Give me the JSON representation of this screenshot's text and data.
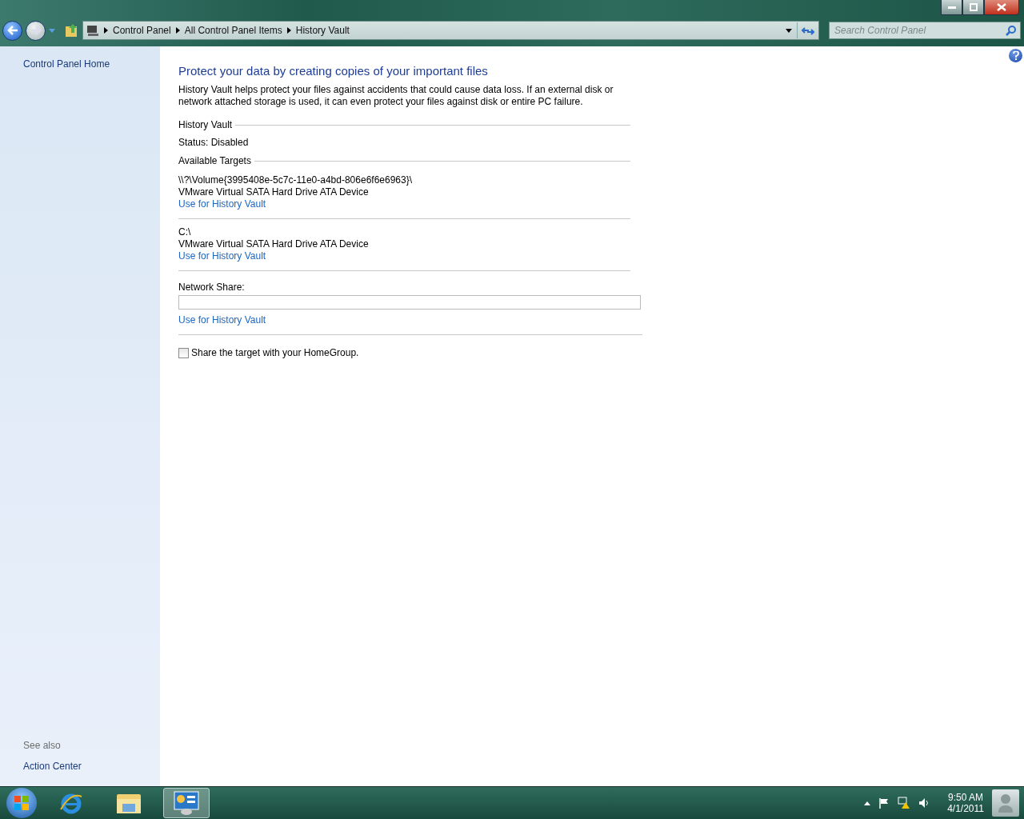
{
  "address_bar": {
    "breadcrumbs": [
      "Control Panel",
      "All Control Panel Items",
      "History Vault"
    ]
  },
  "search": {
    "placeholder": "Search Control Panel"
  },
  "sidebar": {
    "items": [
      "Control Panel Home"
    ],
    "see_also_title": "See also",
    "see_also": [
      "Action Center"
    ]
  },
  "main": {
    "heading": "Protect your data by creating copies of your important files",
    "description": "History Vault helps protect your files against accidents that could cause data loss. If an external disk or network attached storage is used, it can even protect your files against disk or entire PC failure.",
    "status_section": "History Vault",
    "status": "Status: Disabled",
    "targets_section": "Available Targets",
    "targets": [
      {
        "path": "\\\\?\\Volume{3995408e-5c7c-11e0-a4bd-806e6f6e6963}\\",
        "device": "VMware Virtual SATA Hard Drive ATA Device",
        "link": "Use for History Vault"
      },
      {
        "path": "C:\\",
        "device": "VMware Virtual SATA Hard Drive ATA Device",
        "link": "Use for History Vault"
      }
    ],
    "network_share": {
      "label": "Network Share:",
      "link": "Use for History Vault"
    },
    "homegroup": {
      "label": "Share the target with your HomeGroup.",
      "checked": false
    }
  },
  "taskbar": {
    "items": [
      {
        "kind": "ie",
        "selected": false
      },
      {
        "kind": "explorer",
        "selected": false
      },
      {
        "kind": "control",
        "selected": true
      }
    ],
    "clock": {
      "time": "9:50 AM",
      "date": "4/1/2011"
    }
  }
}
